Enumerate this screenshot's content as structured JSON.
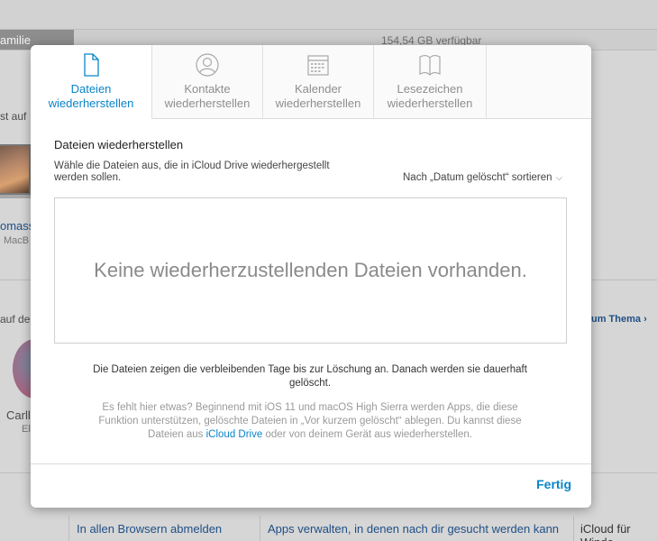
{
  "background": {
    "storage_used_label": "amilie",
    "storage_free": "154,54 GB verfügbar",
    "section_devices_partial": "st auf",
    "device_name_partial": "omass",
    "device_model_partial": "MacB",
    "section_family_partial": "auf de",
    "topic_link_partial": "um Thema",
    "member_name_partial": "Carll",
    "member_role_partial": "El",
    "footer_links": [
      "In allen Browsern abmelden",
      "Apps verwalten, in denen nach dir gesucht werden kann",
      "iCloud für Windo"
    ]
  },
  "modal": {
    "tabs": [
      {
        "label_line1": "Dateien",
        "label_line2": "wiederherstellen",
        "icon": "document-icon",
        "active": true
      },
      {
        "label_line1": "Kontakte",
        "label_line2": "wiederherstellen",
        "icon": "contact-icon",
        "active": false
      },
      {
        "label_line1": "Kalender",
        "label_line2": "wiederherstellen",
        "icon": "calendar-icon",
        "active": false
      },
      {
        "label_line1": "Lesezeichen",
        "label_line2": "wiederherstellen",
        "icon": "bookmark-icon",
        "active": false
      }
    ],
    "title": "Dateien wiederherstellen",
    "instructions": "Wähle die Dateien aus, die in iCloud Drive wiederhergestellt werden sollen.",
    "sort_label": "Nach „Datum gelöscht“ sortieren",
    "empty_message": "Keine wiederherzustellenden Dateien vorhanden.",
    "note": "Die Dateien zeigen die verbleibenden Tage bis zur Löschung an. Danach werden sie dauerhaft gelöscht.",
    "hint_before": "Es fehlt hier etwas? Beginnend mit iOS 11 und macOS High Sierra werden Apps, die diese Funktion unterstützen, gelöschte Dateien in „Vor kurzem gelöscht“ ablegen. Du kannst diese Dateien aus ",
    "hint_link": "iCloud Drive",
    "hint_after": " oder von deinem Gerät aus wiederherstellen.",
    "done_label": "Fertig"
  },
  "colors": {
    "accent": "#0a84c8",
    "overlay": "#d6d6d6"
  }
}
